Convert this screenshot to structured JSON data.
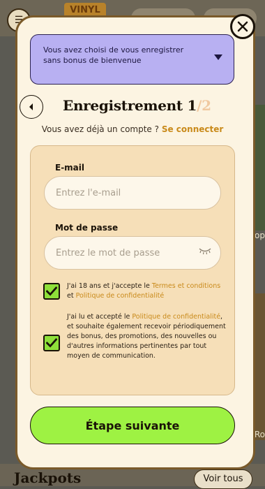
{
  "background": {
    "right_label_1": "op",
    "right_label_2": "Ro",
    "jackpots": "Jackpots",
    "voir_tous": "Voir tous"
  },
  "banner": {
    "text": "Vous avez choisi de vous enregistrer sans bonus de bienvenue"
  },
  "header": {
    "title": "Enregistrement",
    "step_current": "1",
    "step_total": "/2"
  },
  "login": {
    "prompt": "Vous avez déjà un compte ?",
    "link": "Se connecter"
  },
  "form": {
    "email_label": "E-mail",
    "email_placeholder": "Entrez l'e-mail",
    "password_label": "Mot de passe",
    "password_placeholder": "Entrez le mot de passe",
    "terms": {
      "prefix": "J'ai 18 ans et j'accepte le ",
      "link1": "Termes et conditions",
      "middle": " et ",
      "link2": "Politique de confidentialité",
      "checked": true
    },
    "privacy": {
      "prefix": "J'ai lu et accepté le ",
      "link": "Politique de confidentialité",
      "suffix": ", et souhaite également recevoir périodiquement des bonus, des promotions, des nouvelles ou d'autres informations pertinentes par tout moyen de communication.",
      "checked": true
    },
    "submit": "Étape suivante"
  },
  "colors": {
    "accent_green": "#9ef243",
    "banner_purple": "#b8b0f2",
    "link_gold": "#c98a1a",
    "card_bg": "#f6dfb8"
  },
  "icons": {
    "menu": "search-menu-icon",
    "close": "close-icon",
    "back": "chevron-left-icon",
    "dropdown": "chevron-down-icon",
    "eye": "eye-closed-icon",
    "check": "check-icon"
  }
}
